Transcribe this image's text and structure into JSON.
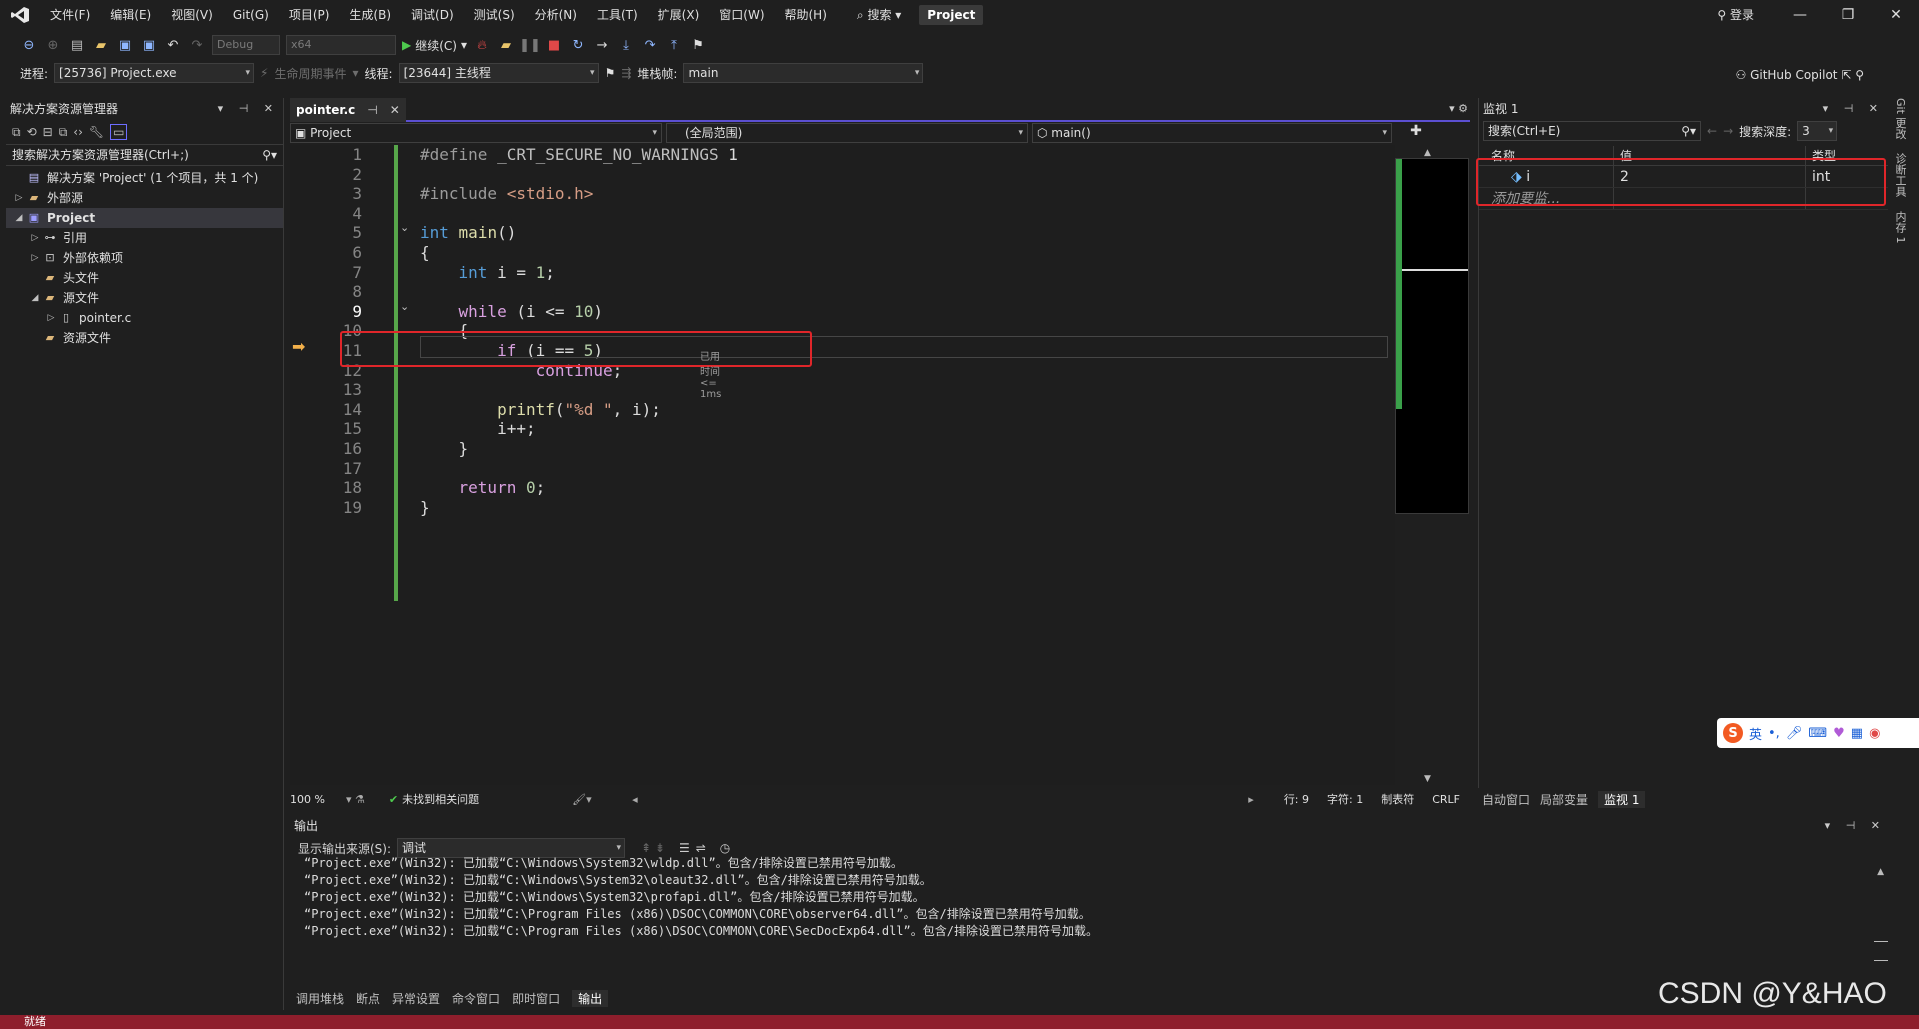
{
  "menu": {
    "items": [
      "文件(F)",
      "编辑(E)",
      "视图(V)",
      "Git(G)",
      "项目(P)",
      "生成(B)",
      "调试(D)",
      "测试(S)",
      "分析(N)",
      "工具(T)",
      "扩展(X)",
      "窗口(W)",
      "帮助(H)"
    ],
    "search_label": "搜索",
    "project_badge": "Project",
    "login": "登录"
  },
  "toolbar": {
    "config": "Debug",
    "platform": "x64",
    "continue_label": "继续(C)",
    "copilot": "GitHub Copilot"
  },
  "debug_bar": {
    "process_label": "进程:",
    "process_value": "[25736] Project.exe",
    "lifecycle_label": "生命周期事件",
    "thread_label": "线程:",
    "thread_value": "[23644] 主线程",
    "stack_label": "堆栈帧:",
    "stack_value": "main"
  },
  "solution_explorer": {
    "title": "解决方案资源管理器",
    "search_placeholder": "搜索解决方案资源管理器(Ctrl+;)",
    "tree": [
      {
        "label": "解决方案 'Project' (1 个项目，共 1 个)",
        "level": 0,
        "icon": "solution-icon",
        "twisty": ""
      },
      {
        "label": "外部源",
        "level": 0,
        "icon": "folder-icon",
        "twisty": "▷"
      },
      {
        "label": "Project",
        "level": 0,
        "icon": "project-icon",
        "twisty": "◢",
        "selected": true
      },
      {
        "label": "引用",
        "level": 1,
        "icon": "reference-icon",
        "twisty": "▷"
      },
      {
        "label": "外部依赖项",
        "level": 1,
        "icon": "dependency-icon",
        "twisty": "▷"
      },
      {
        "label": "头文件",
        "level": 1,
        "icon": "folder-icon",
        "twisty": ""
      },
      {
        "label": "源文件",
        "level": 1,
        "icon": "folder-icon",
        "twisty": "◢"
      },
      {
        "label": "pointer.c",
        "level": 2,
        "icon": "c-file-icon",
        "twisty": "▷"
      },
      {
        "label": "资源文件",
        "level": 1,
        "icon": "folder-icon",
        "twisty": ""
      }
    ]
  },
  "editor": {
    "tab": "pointer.c",
    "nav": {
      "project": "Project",
      "scope": "(全局范围)",
      "function": "main()"
    },
    "elapsed": "已用时间 <= 1ms",
    "current_line": 9,
    "zoom": "100 %",
    "issues": "未找到相关问题",
    "position": {
      "line": "行: 9",
      "col": "字符: 1",
      "tabs": "制表符",
      "eol": "CRLF"
    }
  },
  "code_lines": [
    {
      "n": "1",
      "tokens": [
        [
          "pp",
          "#define "
        ],
        [
          "mac",
          "_CRT_SECURE_NO_WARNINGS"
        ],
        [
          "plain",
          " 1"
        ]
      ]
    },
    {
      "n": "2",
      "tokens": []
    },
    {
      "n": "3",
      "tokens": [
        [
          "pp",
          "#include "
        ],
        [
          "str",
          "<stdio.h>"
        ]
      ]
    },
    {
      "n": "4",
      "tokens": []
    },
    {
      "n": "5",
      "tokens": [
        [
          "kw",
          "int"
        ],
        [
          "plain",
          " "
        ],
        [
          "fn",
          "main"
        ],
        [
          "plain",
          "()"
        ]
      ]
    },
    {
      "n": "6",
      "tokens": [
        [
          "plain",
          "{"
        ]
      ]
    },
    {
      "n": "7",
      "tokens": [
        [
          "plain",
          "    "
        ],
        [
          "kw",
          "int"
        ],
        [
          "plain",
          " i = "
        ],
        [
          "num",
          "1"
        ],
        [
          "plain",
          ";"
        ]
      ]
    },
    {
      "n": "8",
      "tokens": []
    },
    {
      "n": "9",
      "tokens": [
        [
          "plain",
          "    "
        ],
        [
          "kwc",
          "while"
        ],
        [
          "plain",
          " (i <= "
        ],
        [
          "num",
          "10"
        ],
        [
          "plain",
          ")"
        ]
      ]
    },
    {
      "n": "10",
      "tokens": [
        [
          "plain",
          "    {"
        ]
      ]
    },
    {
      "n": "11",
      "tokens": [
        [
          "plain",
          "        "
        ],
        [
          "kwc",
          "if"
        ],
        [
          "plain",
          " (i == "
        ],
        [
          "num",
          "5"
        ],
        [
          "plain",
          ")"
        ]
      ]
    },
    {
      "n": "12",
      "tokens": [
        [
          "plain",
          "            "
        ],
        [
          "kwc",
          "continue"
        ],
        [
          "plain",
          ";"
        ]
      ]
    },
    {
      "n": "13",
      "tokens": []
    },
    {
      "n": "14",
      "tokens": [
        [
          "plain",
          "        "
        ],
        [
          "fn",
          "printf"
        ],
        [
          "plain",
          "("
        ],
        [
          "str",
          "\"%d \""
        ],
        [
          "plain",
          ", i);"
        ]
      ]
    },
    {
      "n": "15",
      "tokens": [
        [
          "plain",
          "        i++;"
        ]
      ]
    },
    {
      "n": "16",
      "tokens": [
        [
          "plain",
          "    }"
        ]
      ]
    },
    {
      "n": "17",
      "tokens": []
    },
    {
      "n": "18",
      "tokens": [
        [
          "plain",
          "    "
        ],
        [
          "kwc",
          "return"
        ],
        [
          "plain",
          " "
        ],
        [
          "num",
          "0"
        ],
        [
          "plain",
          ";"
        ]
      ]
    },
    {
      "n": "19",
      "tokens": [
        [
          "plain",
          "}"
        ]
      ]
    }
  ],
  "watch": {
    "title": "监视 1",
    "search_placeholder": "搜索(Ctrl+E)",
    "depth_label": "搜索深度:",
    "depth_value": "3",
    "headers": {
      "name": "名称",
      "value": "值",
      "type": "类型"
    },
    "rows": [
      {
        "name": "i",
        "value": "2",
        "type": "int"
      }
    ],
    "add_placeholder": "添加要监...",
    "bottom_tabs": [
      "自动窗口",
      "局部变量",
      "监视 1"
    ]
  },
  "output": {
    "title": "输出",
    "source_label": "显示输出来源(S):",
    "source_value": "调试",
    "lines": [
      "“Project.exe”(Win32): 已加载“C:\\Windows\\System32\\wldp.dll”。包含/排除设置已禁用符号加载。",
      "“Project.exe”(Win32): 已加载“C:\\Windows\\System32\\oleaut32.dll”。包含/排除设置已禁用符号加载。",
      "“Project.exe”(Win32): 已加载“C:\\Windows\\System32\\profapi.dll”。包含/排除设置已禁用符号加载。",
      "“Project.exe”(Win32): 已加载“C:\\Program Files (x86)\\DSOC\\COMMON\\CORE\\observer64.dll”。包含/排除设置已禁用符号加载。",
      "“Project.exe”(Win32): 已加载“C:\\Program Files (x86)\\DSOC\\COMMON\\CORE\\SecDocExp64.dll”。包含/排除设置已禁用符号加载。"
    ]
  },
  "bottom_tabs": [
    "调用堆栈",
    "断点",
    "异常设置",
    "命令窗口",
    "即时窗口",
    "输出"
  ],
  "right_strip": [
    "Git 更改",
    "诊断工具",
    "内存 1"
  ],
  "ime": {
    "lang": "英"
  },
  "status": {
    "ready": "就绪"
  },
  "watermark": "CSDN @Y&HAO"
}
